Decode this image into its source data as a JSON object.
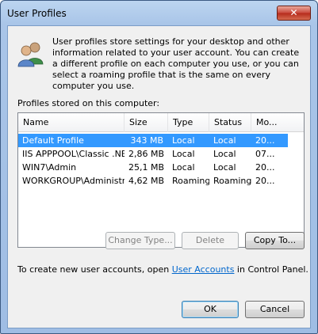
{
  "window": {
    "title": "User Profiles",
    "close_glyph": "✕"
  },
  "header": {
    "icon": "users-icon",
    "description": "User profiles store settings for your desktop and other information related to your user account. You can create a different profile on each computer you use, or you can select a roaming profile that is the same on every computer you use."
  },
  "profiles": {
    "label": "Profiles stored on this computer:",
    "columns": [
      "Name",
      "Size",
      "Type",
      "Status",
      "Mo..."
    ],
    "rows": [
      {
        "name": "Default Profile",
        "size": "343 MB",
        "type": "Local",
        "status": "Local",
        "modified": "20...",
        "selected": true
      },
      {
        "name": "IIS APPPOOL\\Classic .NE...",
        "size": "2,86 MB",
        "type": "Local",
        "status": "Local",
        "modified": "07...",
        "selected": false
      },
      {
        "name": "WIN7\\Admin",
        "size": "25,1 MB",
        "type": "Local",
        "status": "Local",
        "modified": "20...",
        "selected": false
      },
      {
        "name": "WORKGROUP\\Administra...",
        "size": "4,62 MB",
        "type": "Roaming",
        "status": "Roaming",
        "modified": "20...",
        "selected": false
      }
    ]
  },
  "buttons": {
    "change_type": "Change Type...",
    "delete": "Delete",
    "copy_to": "Copy To...",
    "ok": "OK",
    "cancel": "Cancel"
  },
  "footer": {
    "prefix": "To create new user accounts, open ",
    "link": "User Accounts",
    "suffix": " in Control Panel."
  },
  "colors": {
    "selection": "#3399ff",
    "link": "#0066cc"
  }
}
